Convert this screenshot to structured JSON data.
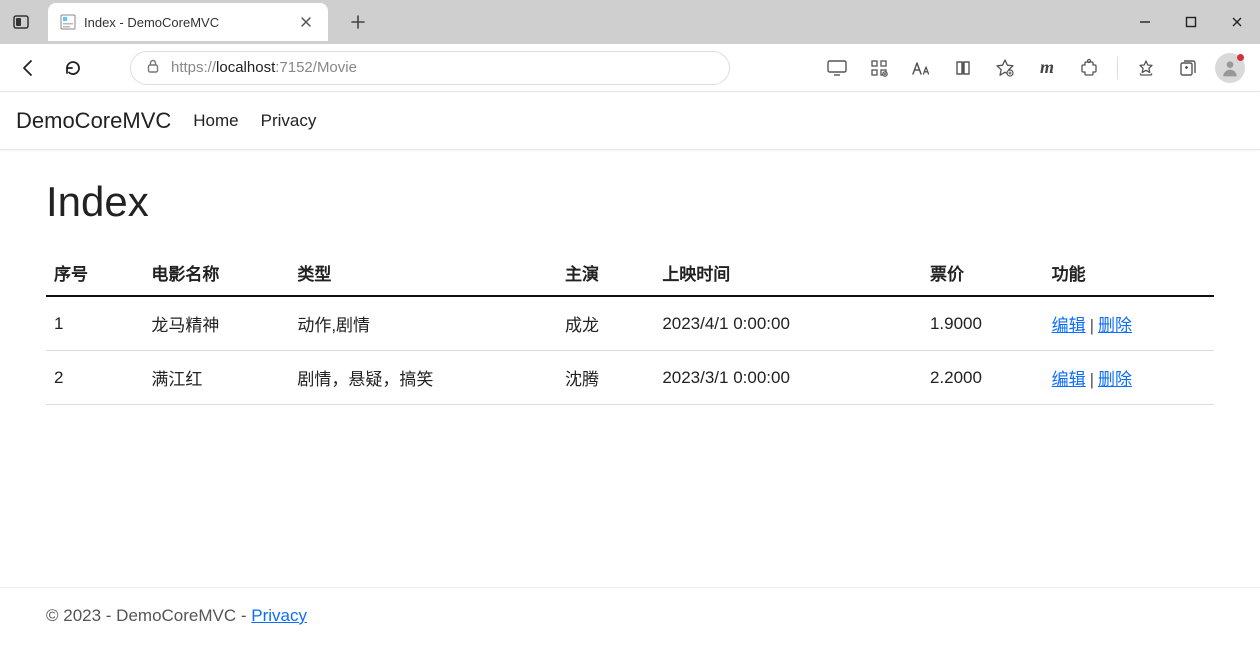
{
  "browser": {
    "tab_title": "Index - DemoCoreMVC",
    "url_proto": "https://",
    "url_host": "localhost",
    "url_rest": ":7152/Movie"
  },
  "navbar": {
    "brand": "DemoCoreMVC",
    "links": [
      {
        "label": "Home"
      },
      {
        "label": "Privacy"
      }
    ]
  },
  "page_title": "Index",
  "table": {
    "headers": [
      "序号",
      "电影名称",
      "类型",
      "主演",
      "上映时间",
      "票价",
      "功能"
    ],
    "rows": [
      {
        "id": "1",
        "name": "龙马精神",
        "type": "动作,剧情",
        "actor": "成龙",
        "date": "2023/4/1 0:00:00",
        "price": "1.9000"
      },
      {
        "id": "2",
        "name": "满江红",
        "type": "剧情，悬疑，搞笑",
        "actor": "沈腾",
        "date": "2023/3/1 0:00:00",
        "price": "2.2000"
      }
    ],
    "actions": {
      "edit": "编辑",
      "delete": "删除"
    }
  },
  "footer": {
    "text": "© 2023 - DemoCoreMVC - ",
    "privacy": "Privacy"
  }
}
